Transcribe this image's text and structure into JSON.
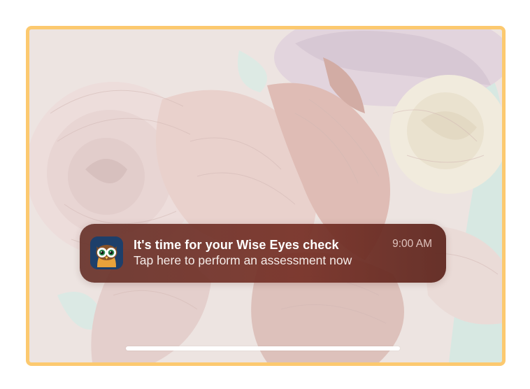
{
  "device": {
    "frame_color": "#fcc96f"
  },
  "wallpaper": {
    "description_icon": "rose-pattern-wallpaper"
  },
  "notification": {
    "app_icon": "owl-app-icon",
    "title": "It's time for your Wise Eyes check",
    "body": "Tap here to perform an assessment now",
    "time": "9:00 AM",
    "background_color": "#6e3027"
  },
  "home_indicator": {
    "color": "#ffffff"
  }
}
